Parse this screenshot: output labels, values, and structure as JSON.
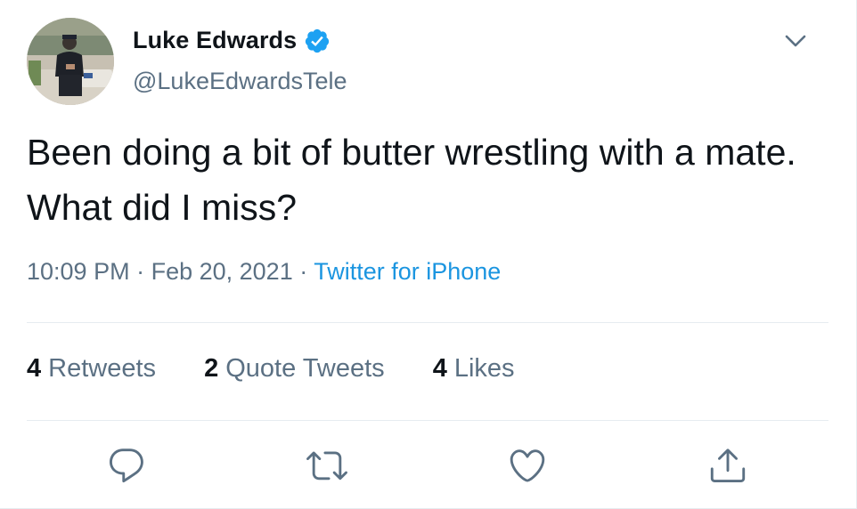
{
  "author": {
    "display_name": "Luke Edwards",
    "handle": "@LukeEdwardsTele",
    "verified": true
  },
  "tweet": {
    "text": "Been doing a bit of butter wrestling with a mate. What did I miss?",
    "time": "10:09 PM",
    "date": "Feb 20, 2021",
    "source": "Twitter for iPhone",
    "separator": " · "
  },
  "stats": {
    "retweets_count": "4",
    "retweets_label": "Retweets",
    "quotes_count": "2",
    "quotes_label": "Quote Tweets",
    "likes_count": "4",
    "likes_label": "Likes"
  },
  "icons": {
    "verified": "verified-badge-icon",
    "caret": "chevron-down-icon",
    "reply": "reply-icon",
    "retweet": "retweet-icon",
    "like": "heart-icon",
    "share": "share-icon"
  },
  "colors": {
    "text": "#0f1419",
    "secondary": "#5b7083",
    "accent": "#1b95e0",
    "divider": "#e6ecf0"
  }
}
